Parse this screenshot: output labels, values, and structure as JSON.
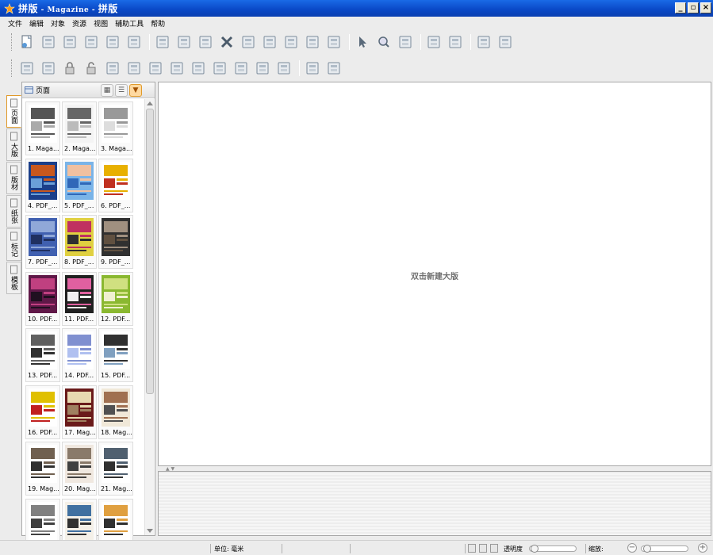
{
  "window": {
    "title_main": "拼版",
    "title_sep1": " - ",
    "title_sub": "Magazine",
    "title_sep2": " - ",
    "title_tail": "拼版",
    "minimize": "_",
    "restore": "▫",
    "close": "×"
  },
  "menu": [
    "文件",
    "编辑",
    "对象",
    "资源",
    "视图",
    "辅助工具",
    "帮助"
  ],
  "toolbar1_icons": [
    "new-doc-icon",
    "save-icon",
    "save-as-icon",
    "print-icon",
    "export-icon",
    "import-icon",
    "undo-icon",
    "redo-icon",
    "crop-icon",
    "delete-icon",
    "cut-icon",
    "swap-icon",
    "columns-icon",
    "grid-icon",
    "page-icon",
    "pointer-icon",
    "zoom-icon",
    "rotate-icon",
    "fit-icon",
    "zoom-fit-icon",
    "left-page-icon",
    "right-page-icon"
  ],
  "toolbar2_icons": [
    "group-icon",
    "ungroup-icon",
    "lock-icon",
    "unlock-icon",
    "align-top-icon",
    "align-middle-icon",
    "align-bottom-icon",
    "align-left-icon",
    "align-center-icon",
    "align-right-icon",
    "distribute-h-icon",
    "distribute-v-icon",
    "columns-split-icon",
    "pages-icon",
    "page-add-icon"
  ],
  "side_tabs": [
    {
      "label": "页面",
      "icon": "page-icon"
    },
    {
      "label": "大版",
      "icon": "sheet-icon"
    },
    {
      "label": "版材",
      "icon": "plate-icon"
    },
    {
      "label": "纸张",
      "icon": "paper-icon"
    },
    {
      "label": "标记",
      "icon": "mark-icon"
    },
    {
      "label": "模板",
      "icon": "template-icon"
    }
  ],
  "panel": {
    "title": "页面",
    "view_grid": "▦",
    "view_list": "☰",
    "view_menu": "▼"
  },
  "thumbnails": [
    {
      "label": "1. Maga...",
      "palette": [
        "#fff",
        "#555",
        "#aaa"
      ]
    },
    {
      "label": "2. Maga...",
      "palette": [
        "#f4f4f4",
        "#666",
        "#bbb"
      ]
    },
    {
      "label": "3. Maga...",
      "palette": [
        "#fff",
        "#999",
        "#ddd"
      ]
    },
    {
      "label": "4. PDF_...",
      "palette": [
        "#1b3f8a",
        "#c8581e",
        "#6ba0d8"
      ]
    },
    {
      "label": "5. PDF_...",
      "palette": [
        "#7ab4e8",
        "#f0c0a0",
        "#3068b8"
      ]
    },
    {
      "label": "6. PDF_...",
      "palette": [
        "#fff",
        "#e8b000",
        "#c03020"
      ]
    },
    {
      "label": "7. PDF_...",
      "palette": [
        "#4060b0",
        "#90a8d8",
        "#203060"
      ]
    },
    {
      "label": "8. PDF_...",
      "palette": [
        "#e0d040",
        "#c03060",
        "#303030"
      ]
    },
    {
      "label": "9. PDF_...",
      "palette": [
        "#303030",
        "#a09080",
        "#605040"
      ]
    },
    {
      "label": "10. PDF...",
      "palette": [
        "#601848",
        "#c04080",
        "#201020"
      ]
    },
    {
      "label": "11. PDF...",
      "palette": [
        "#202020",
        "#e060a0",
        "#f0f0f0"
      ]
    },
    {
      "label": "12. PDF...",
      "palette": [
        "#8ab830",
        "#d0e080",
        "#f0f0d0"
      ]
    },
    {
      "label": "13. PDF...",
      "palette": [
        "#fff",
        "#606060",
        "#303030"
      ]
    },
    {
      "label": "14. PDF...",
      "palette": [
        "#fff",
        "#8090d0",
        "#b0c0f0"
      ]
    },
    {
      "label": "15. PDF...",
      "palette": [
        "#fff",
        "#303030",
        "#80a0c0"
      ]
    },
    {
      "label": "16. PDF...",
      "palette": [
        "#fff",
        "#e0c000",
        "#c02020"
      ]
    },
    {
      "label": "17. Mag...",
      "palette": [
        "#6a1a1a",
        "#e8d8b0",
        "#a08060"
      ]
    },
    {
      "label": "18. Mag...",
      "palette": [
        "#f0e8d8",
        "#a07050",
        "#505050"
      ]
    },
    {
      "label": "19. Mag...",
      "palette": [
        "#fff",
        "#706050",
        "#303030"
      ]
    },
    {
      "label": "20. Mag...",
      "palette": [
        "#f0e8e0",
        "#8a7a6a",
        "#404040"
      ]
    },
    {
      "label": "21. Mag...",
      "palette": [
        "#fff",
        "#506070",
        "#303030"
      ]
    },
    {
      "label": "",
      "palette": [
        "#fff",
        "#808080",
        "#404040"
      ]
    },
    {
      "label": "",
      "palette": [
        "#f4f0e8",
        "#4070a0",
        "#303030"
      ]
    },
    {
      "label": "",
      "palette": [
        "#fff",
        "#e0a040",
        "#303030"
      ]
    }
  ],
  "canvas": {
    "hint": "双击新建大版"
  },
  "status": {
    "unit_label": "单位: 毫米",
    "opacity_label": "透明度",
    "zoom_label": "缩放:",
    "zoom_out": "−",
    "zoom_in": "+"
  }
}
